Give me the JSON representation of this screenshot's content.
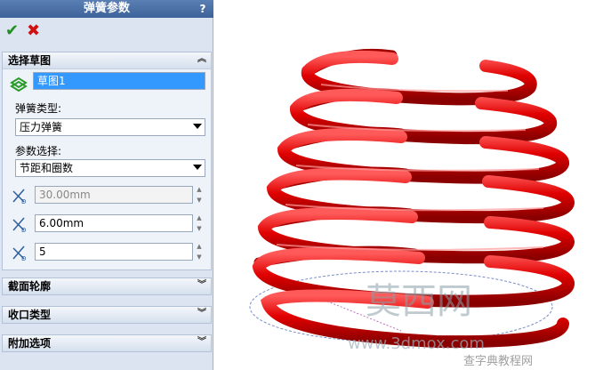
{
  "panel": {
    "title": "弹簧参数",
    "help": "?",
    "ok_label": "✔",
    "cancel_label": "✖"
  },
  "sketch_group": {
    "header": "选择草图",
    "selected_sketch": "草图1",
    "spring_type_label": "弹簧类型:",
    "spring_type_value": "压力弹簧",
    "param_label": "参数选择:",
    "param_value": "节距和圈数",
    "param1": "30.00mm",
    "param2": "6.00mm",
    "param3": "5"
  },
  "collapsed_groups": [
    "截面轮廓",
    "收口类型",
    "附加选项"
  ],
  "watermark": {
    "text1": "莫西网",
    "text2": "www.3dmox.com",
    "text3": "查字典教程网"
  },
  "colors": {
    "spring": "#e00000",
    "panel_bg": "#dbe4f0",
    "title_bg": "#3d6299"
  }
}
